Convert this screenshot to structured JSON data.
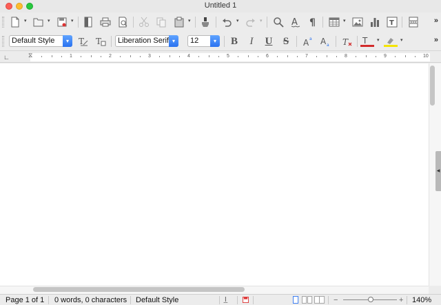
{
  "window": {
    "title": "Untitled 1"
  },
  "formatting": {
    "paragraph_style": "Default Style",
    "font_name": "Liberation Serif",
    "font_size": "12",
    "bold_label": "B",
    "italic_label": "I",
    "underline_label": "U",
    "strike_label": "S",
    "font_color": "#d22b2b",
    "highlight_color": "#f5e400"
  },
  "ruler": {
    "numbers": [
      "1",
      "2",
      "3",
      "4",
      "5",
      "6",
      "7",
      "8",
      "9",
      "10"
    ]
  },
  "statusbar": {
    "page": "Page 1 of 1",
    "words": "0 words, 0 characters",
    "page_style": "Default Style",
    "zoom_minus": "−",
    "zoom_plus": "+",
    "zoom": "140%"
  },
  "icons": [
    "new-document-icon",
    "open-folder-icon",
    "save-icon",
    "export-pdf-icon",
    "print-icon",
    "print-preview-icon",
    "cut-icon",
    "copy-icon",
    "paste-icon",
    "clone-formatting-icon",
    "undo-icon",
    "redo-icon",
    "find-replace-icon",
    "spelling-icon",
    "formatting-marks-icon",
    "insert-table-icon",
    "insert-image-icon",
    "insert-chart-icon",
    "insert-textbox-icon",
    "page-break-icon"
  ]
}
